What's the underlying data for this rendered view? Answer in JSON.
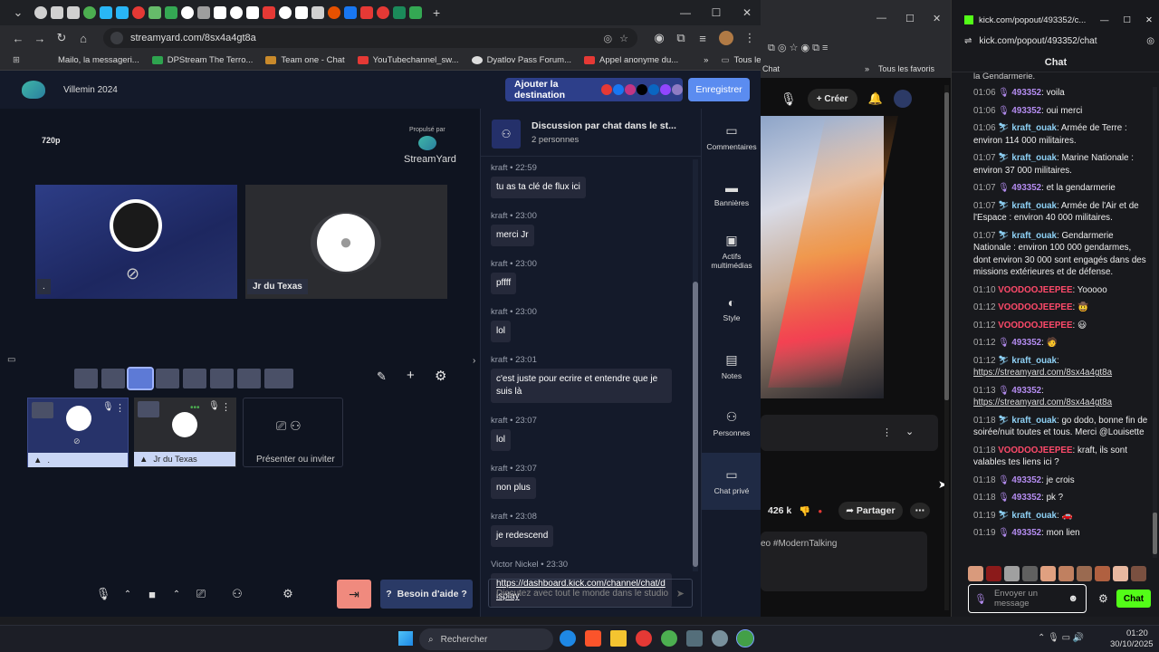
{
  "browser_tabs_count": 24,
  "url": "streamyard.com/8sx4a4gt8a",
  "bookmarks": [
    "Mailo, la messageri...",
    "DPStream The Terro...",
    "Team one - Chat",
    "YouTubechannel_sw...",
    "Dyatlov Pass Forum...",
    "Appel anonyme du..."
  ],
  "bookmarks_folder": "Tous les favoris",
  "streamyard": {
    "studio_name": "Villemin 2024",
    "add_destination": "Ajouter la destination",
    "record": "Enregistrer",
    "quality": "720p",
    "powered_by": "Propulsé par",
    "brand": "StreamYard",
    "tile1_name": ".",
    "tile2_name": "Jr du Texas",
    "cam1_name": ".",
    "cam2_name": "Jr du Texas",
    "invite": "Présenter ou inviter",
    "help": "Besoin d'aide ?",
    "chat_title": "Discussion par chat dans le st...",
    "chat_people": "2 personnes",
    "chat_input_placeholder": "Discutez avec tout le monde dans le studio",
    "messages": [
      {
        "name": "kraft",
        "time": "22:59",
        "text": "tu as ta clé de flux ici"
      },
      {
        "name": "kraft",
        "time": "23:00",
        "text": "merci Jr"
      },
      {
        "name": "kraft",
        "time": "23:00",
        "text": "pffff"
      },
      {
        "name": "kraft",
        "time": "23:00",
        "text": "lol"
      },
      {
        "name": "kraft",
        "time": "23:01",
        "text": "c'est juste pour ecrire et entendre que je suis là"
      },
      {
        "name": "kraft",
        "time": "23:07",
        "text": "lol"
      },
      {
        "name": "kraft",
        "time": "23:07",
        "text": "non plus"
      },
      {
        "name": "kraft",
        "time": "23:08",
        "text": "je redescend"
      },
      {
        "name": "Victor Nickel",
        "time": "23:30",
        "text": "https://dashboard.kick.com/channel/chat/display"
      }
    ],
    "rail": [
      "Commentaires",
      "Bannières",
      "Actifs multimédias",
      "Style",
      "Notes",
      "Personnes",
      "Chat privé"
    ]
  },
  "middle": {
    "favorites": "Tous les favoris",
    "chat_tab": "Chat",
    "create": "Créer",
    "likes": "426 k",
    "share": "Partager",
    "hashtag": "eo #ModernTalking"
  },
  "kick": {
    "tab_title": "kick.com/popout/493352/c...",
    "url": "kick.com/popout/493352/chat",
    "header": "Chat",
    "input_placeholder": "Envoyer un message",
    "send": "Chat",
    "messages": [
      {
        "time": "01:06",
        "user": "493352",
        "type": "u1",
        "text": "voila"
      },
      {
        "time": "01:06",
        "user": "493352",
        "type": "u1",
        "text": "oui merci"
      },
      {
        "time": "01:06",
        "user": "kraft_ouak",
        "type": "u2",
        "text": "Armée de Terre : environ 114 000 militaires."
      },
      {
        "time": "01:07",
        "user": "kraft_ouak",
        "type": "u2",
        "text": "Marine Nationale : environ 37 000 militaires."
      },
      {
        "time": "01:07",
        "user": "493352",
        "type": "u1",
        "text": "et la gendarmerie"
      },
      {
        "time": "01:07",
        "user": "kraft_ouak",
        "type": "u2",
        "text": "Armée de l'Air et de l'Espace : environ 40 000 militaires."
      },
      {
        "time": "01:07",
        "user": "kraft_ouak",
        "type": "u2",
        "text": "Gendarmerie Nationale : environ 100 000 gendarmes, dont environ 30 000 sont engagés dans des missions extérieures et de défense."
      },
      {
        "time": "01:10",
        "user": "VOODOOJEEPEE",
        "type": "u3",
        "text": "Yooooo"
      },
      {
        "time": "01:12",
        "user": "VOODOOJEEPEE",
        "type": "u3",
        "text": "🤠"
      },
      {
        "time": "01:12",
        "user": "VOODOOJEEPEE",
        "type": "u3",
        "text": "😃"
      },
      {
        "time": "01:12",
        "user": "493352",
        "type": "u1",
        "text": "🧑"
      },
      {
        "time": "01:12",
        "user": "kraft_ouak",
        "type": "u2",
        "text": "https://streamyard.com/8sx4a4gt8a"
      },
      {
        "time": "01:13",
        "user": "493352",
        "type": "u1",
        "text": "https://streamyard.com/8sx4a4gt8a"
      },
      {
        "time": "01:18",
        "user": "kraft_ouak",
        "type": "u2",
        "text": "go dodo, bonne fin de soirée/nuit toutes et tous. Merci @Louisette"
      },
      {
        "time": "01:18",
        "user": "VOODOOJEEPEE",
        "type": "u3",
        "text": "kraft, ils sont valables tes liens ici ?"
      },
      {
        "time": "01:18",
        "user": "493352",
        "type": "u1",
        "text": "je crois"
      },
      {
        "time": "01:18",
        "user": "493352",
        "type": "u1",
        "text": "pk ?"
      },
      {
        "time": "01:19",
        "user": "kraft_ouak",
        "type": "u2",
        "text": "🚗"
      },
      {
        "time": "01:19",
        "user": "493352",
        "type": "u1",
        "text": "mon lien"
      }
    ]
  },
  "taskbar": {
    "search": "Rechercher",
    "time": "01:20",
    "date": "30/10/2025"
  }
}
